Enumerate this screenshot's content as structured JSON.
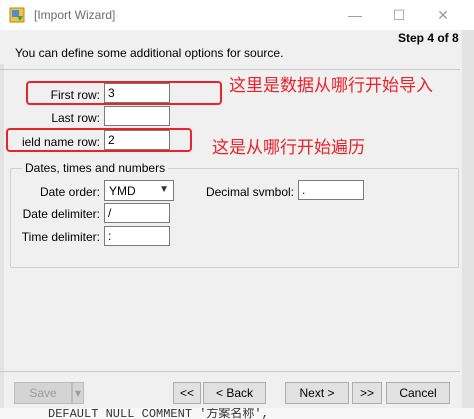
{
  "window": {
    "title": "[Import Wizard]",
    "minimize_glyph": "—",
    "maximize_glyph": "☐",
    "close_glyph": "✕",
    "icon": "import-wizard-icon"
  },
  "header": {
    "intro": "You can define some additional options for source.",
    "step": "Step 4 of 8"
  },
  "rows": {
    "first_row_label": "First row:",
    "first_row_value": "3",
    "last_row_label": "Last row:",
    "last_row_value": "",
    "field_name_row_label": "ield name row:",
    "field_name_row_value": "2"
  },
  "annotations": {
    "first_row_note": "这里是数据从哪行开始导入",
    "field_name_note": "这是从哪行开始遍历",
    "color": "#e8232b"
  },
  "dates": {
    "group_title": "Dates, times and numbers",
    "date_order_label": "Date order:",
    "date_order_value": "YMD",
    "decimal_symbol_label": "Decimal svmbol:",
    "decimal_symbol_value": ".",
    "date_delimiter_label": "Date delimiter:",
    "date_delimiter_value": "/",
    "time_delimiter_label": "Time delimiter:",
    "time_delimiter_value": ":"
  },
  "footer": {
    "save_label": "Save",
    "save_dropdown": "▾",
    "first_label": "<<",
    "back_label": "< Back",
    "next_label": "Next >",
    "last_label": ">>",
    "cancel_label": "Cancel"
  },
  "background_text": "DEFAULT NULL COMMENT '方案名称',"
}
